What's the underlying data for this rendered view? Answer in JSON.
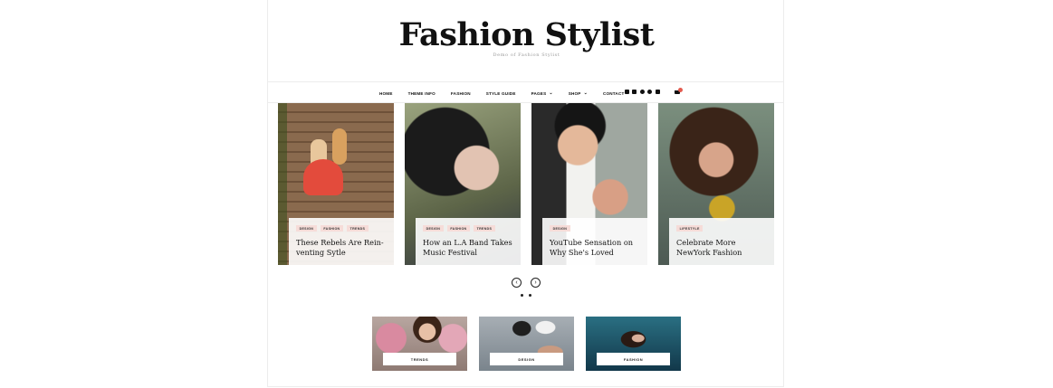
{
  "site": {
    "title": "Fashion Stylist",
    "tagline": "Demo of Fashion Stylist"
  },
  "nav": {
    "items": [
      {
        "label": "HOME",
        "has_dropdown": false
      },
      {
        "label": "THEME INFO",
        "has_dropdown": false
      },
      {
        "label": "FASHION",
        "has_dropdown": false
      },
      {
        "label": "STYLE GUIDE",
        "has_dropdown": false
      },
      {
        "label": "PAGES",
        "has_dropdown": true
      },
      {
        "label": "SHOP",
        "has_dropdown": true
      },
      {
        "label": "CONTACT",
        "has_dropdown": false
      }
    ],
    "social_icons": [
      "facebook-icon",
      "twitter-icon",
      "instagram-icon",
      "pinterest-icon",
      "xing-icon"
    ],
    "cart_icon": "cart-icon"
  },
  "slider": {
    "cards": [
      {
        "tags": [
          "DESIGN",
          "FASHION",
          "TRENDS"
        ],
        "title": "These Rebels Are Rein-venting Sytle"
      },
      {
        "tags": [
          "DESIGN",
          "FASHION",
          "TRENDS"
        ],
        "title": "How an L.A Band Takes Music Festival"
      },
      {
        "tags": [
          "DESIGN"
        ],
        "title": "YouTube Sensation on Why She's Loved"
      },
      {
        "tags": [
          "LIFESTYLE"
        ],
        "title": "Celebrate More NewYork Fashion"
      }
    ],
    "prev_icon": "chevron-left-icon",
    "next_icon": "chevron-right-icon",
    "pages": 2,
    "active_page": 1
  },
  "categories": [
    {
      "label": "TRENDS"
    },
    {
      "label": "DESIGN"
    },
    {
      "label": "FASHION"
    }
  ],
  "colors": {
    "tag_bg": "#f6dcd8",
    "accent": "#e35b4f",
    "text": "#111111"
  }
}
